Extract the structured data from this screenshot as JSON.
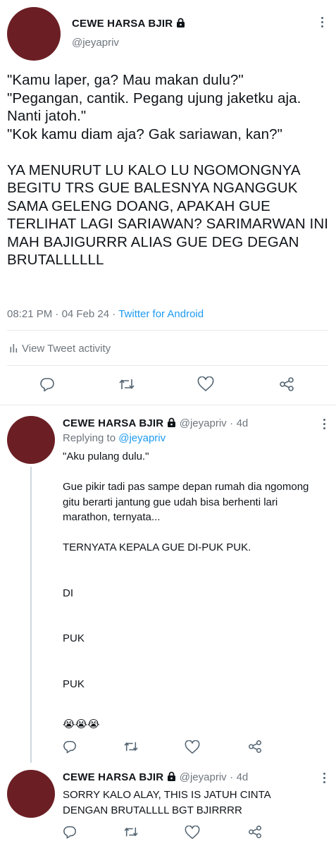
{
  "main_tweet": {
    "author_name": "CEWE HARSA BJIR",
    "handle": "@jeyapriv",
    "text": "\"Kamu laper, ga? Mau makan dulu?\"\n\"Pegangan, cantik. Pegang ujung jaketku aja. Nanti jatoh.\"\n\"Kok kamu diam aja? Gak sariawan, kan?\"\n\nYA MENURUT LU KALO LU NGOMONGNYA BEGITU TRS GUE BALESNYA NGANGGUK SAMA GELENG DOANG, APAKAH GUE TERLIHAT LAGI SARIAWAN? SARIMARWAN INI MAH BAJIGURRR ALIAS GUE DEG DEGAN BRUTALLLLLL",
    "time": "08:21 PM",
    "dot": "·",
    "date": "04 Feb 24",
    "source": "Twitter for Android",
    "view_activity": "View Tweet activity"
  },
  "reply_1": {
    "author_name": "CEWE HARSA BJIR",
    "handle": "@jeyapriv",
    "dot": "·",
    "age": "4d",
    "replying_prefix": "Replying to",
    "replying_to": "@jeyapriv",
    "text": "\"Aku pulang dulu.\"\n\nGue pikir tadi pas sampe depan rumah dia ngomong gitu berarti jantung gue udah bisa berhenti lari marathon, ternyata...\n\nTERNYATA KEPALA GUE DI-PUK PUK.\n\n\nDI\n\n\nPUK\n\n\nPUK\n\n",
    "emoji": "😭😭😭"
  },
  "reply_2": {
    "author_name": "CEWE HARSA BJIR",
    "handle": "@jeyapriv",
    "dot": "·",
    "age": "4d",
    "text": "SORRY KALO ALAY, THIS IS JATUH CINTA DENGAN BRUTALLLL BGT BJIRRRR"
  },
  "icons": {
    "lock": "lock-icon",
    "more": "more-icon",
    "reply": "reply-icon",
    "retweet": "retweet-icon",
    "like": "like-icon",
    "share": "share-icon",
    "activity": "activity-icon"
  },
  "colors": {
    "avatar": "#6b1f24",
    "link": "#1d9bf0",
    "muted": "#6e767d",
    "divider": "#e7e9ea",
    "icon": "#536471"
  }
}
